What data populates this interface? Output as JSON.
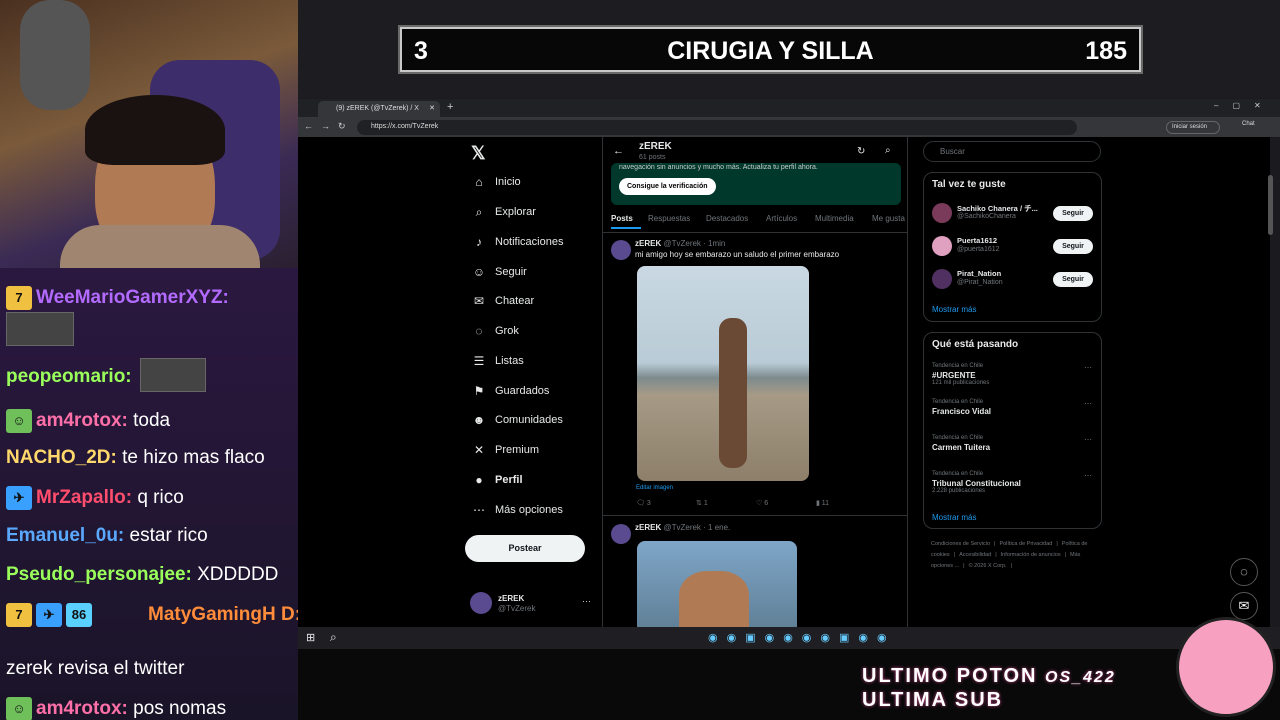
{
  "banner": {
    "number": "3",
    "title": "CIRUGIA Y SILLA",
    "count": "185"
  },
  "browser": {
    "tab_title": "(9) zEREK (@TvZerek) / X",
    "url": "https://x.com/TvZerek",
    "signin": "Iniciar sesión",
    "chat": "Chat"
  },
  "nav": [
    {
      "label": "Inicio",
      "icon": "home-icon",
      "glyph": "⌂"
    },
    {
      "label": "Explorar",
      "icon": "search-icon",
      "glyph": "⌕"
    },
    {
      "label": "Notificaciones",
      "icon": "bell-icon",
      "glyph": "♪"
    },
    {
      "label": "Seguir",
      "icon": "follow-icon",
      "glyph": "☺"
    },
    {
      "label": "Chatear",
      "icon": "mail-icon",
      "glyph": "✉"
    },
    {
      "label": "Grok",
      "icon": "grok-icon",
      "glyph": "◌"
    },
    {
      "label": "Listas",
      "icon": "list-icon",
      "glyph": "☰"
    },
    {
      "label": "Guardados",
      "icon": "bookmark-icon",
      "glyph": "⚑"
    },
    {
      "label": "Comunidades",
      "icon": "community-icon",
      "glyph": "☻"
    },
    {
      "label": "Premium",
      "icon": "x-icon",
      "glyph": "✕"
    },
    {
      "label": "Perfil",
      "icon": "profile-icon",
      "glyph": "●"
    },
    {
      "label": "Más opciones",
      "icon": "more-icon",
      "glyph": "⋯"
    }
  ],
  "post_button": "Postear",
  "account": {
    "name": "zEREK",
    "handle": "@TvZerek"
  },
  "profile": {
    "name": "zEREK",
    "posts": "61 posts",
    "promo_text": "navegación sin anuncios y mucho más. Actualiza tu perfil ahora.",
    "verify_button": "Consigue la verificación"
  },
  "tabs": [
    "Posts",
    "Respuestas",
    "Destacados",
    "Artículos",
    "Multimedia",
    "Me gusta"
  ],
  "posts": [
    {
      "author": "zEREK",
      "meta": "@TvZerek · 1min",
      "text": "mi amigo hoy se embarazo un saludo el primer embarazo",
      "edit": "Editar imagen",
      "replies": "3",
      "reposts": "1",
      "likes": "6",
      "views": "11"
    },
    {
      "author": "zEREK",
      "meta": "@TvZerek · 1 ene."
    }
  ],
  "search_placeholder": "Buscar",
  "suggest": {
    "title": "Tal vez te guste",
    "more": "Mostrar más",
    "follow_label": "Seguir",
    "users": [
      {
        "name": "Sachiko Chanera / チ...",
        "handle": "@SachikoChanera",
        "color": "#7a3a5a"
      },
      {
        "name": "Puerta1612",
        "handle": "@puerta1612",
        "color": "#e0a0c0"
      },
      {
        "name": "Pirat_Nation",
        "handle": "@Pirat_Nation",
        "color": "#503060"
      }
    ]
  },
  "trends": {
    "title": "Qué está pasando",
    "more": "Mostrar más",
    "items": [
      {
        "ctx": "Tendencia en Chile",
        "name": "#URGENTE",
        "count": "121 mil publicaciones"
      },
      {
        "ctx": "Tendencia en Chile",
        "name": "Francisco Vidal",
        "count": ""
      },
      {
        "ctx": "Tendencia en Chile",
        "name": "Carmen Tuitera",
        "count": ""
      },
      {
        "ctx": "Tendencia en Chile",
        "name": "Tribunal Constitucional",
        "count": "2.228 publicaciones"
      }
    ]
  },
  "footer": [
    "Condiciones de Servicio",
    "Política de Privacidad",
    "Política de cookies",
    "Accesibilidad",
    "Información de anuncios",
    "Más opciones ...",
    "© 2026 X Corp."
  ],
  "chat": [
    {
      "user": "WeeMarioGamerXYZ:",
      "color": "#b36bff",
      "text": ""
    },
    {
      "user": "peopeomario:",
      "color": "#9aff5a",
      "text": ""
    },
    {
      "user": "am4rotox:",
      "color": "#ff6fa8",
      "text": " toda"
    },
    {
      "user": "NACHO_2D:",
      "color": "#ffd86b",
      "text": " te hizo mas flaco"
    },
    {
      "user": "MrZapallo:",
      "color": "#ff4d6d",
      "text": " q rico"
    },
    {
      "user": "Emanuel_0u:",
      "color": "#5aa9ff",
      "text": " estar rico"
    },
    {
      "user": "Pseudo_personajee:",
      "color": "#9aff5a",
      "text": " XDDDDD"
    },
    {
      "user": "MatyGamingH D:",
      "color": "#ff8c3a",
      "text": ""
    },
    {
      "user": "",
      "color": "#ffffff",
      "text": "zerek revisa el twitter"
    },
    {
      "user": "am4rotox:",
      "color": "#ff6fa8",
      "text": " pos nomas"
    }
  ],
  "overlay_text": [
    "ULTIMO POTON",
    "ULTIMA SUB"
  ],
  "overlay_tag": "OS_422"
}
